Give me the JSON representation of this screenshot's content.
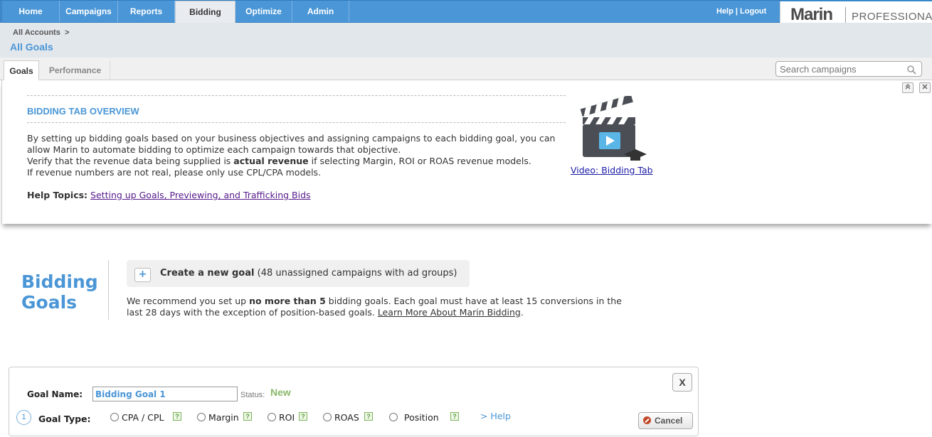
{
  "topnav": {
    "tabs": [
      {
        "label": "Home"
      },
      {
        "label": "Campaigns"
      },
      {
        "label": "Reports"
      },
      {
        "label": "Bidding",
        "active": true
      },
      {
        "label": "Optimize"
      },
      {
        "label": "Admin"
      }
    ],
    "help": "Help",
    "separator": "|",
    "logout": "Logout",
    "logo_word": "Marin",
    "logo_edition": "PROFESSIONAL"
  },
  "breadcrumb": {
    "parent": "All Accounts",
    "arrow": ">",
    "title": "All Goals"
  },
  "subtabs": [
    {
      "label": "Goals",
      "active": true
    },
    {
      "label": "Performance"
    }
  ],
  "search": {
    "placeholder": "Search campaigns",
    "icon": "search-icon"
  },
  "overview": {
    "title": "BIDDING TAB OVERVIEW",
    "para1": "By setting up bidding goals based on your business objectives and assigning campaigns to each bidding goal, you can allow Marin to automate bidding to optimize each campaign towards that objective.",
    "para2_pre": "Verify that the revenue data being supplied is ",
    "para2_bold": "actual revenue",
    "para2_post": " if selecting Margin, ROI or ROAS revenue models.",
    "para3": "If revenue numbers are not real, please only use CPL/CPA models.",
    "help_label": "Help Topics:",
    "help_link": "Setting up Goals, Previewing, and Trafficking Bids",
    "video_link": "Video: Bidding Tab",
    "collapse_icon": "collapse-up-icon",
    "close_icon": "close-icon"
  },
  "bidding": {
    "title_line1": "Bidding",
    "title_line2": "Goals",
    "create_plus": "+",
    "create_bold": "Create a new goal",
    "create_rest": " (48 unassigned campaigns with ad groups)",
    "rec_pre": "We recommend you set up ",
    "rec_bold": "no more than 5",
    "rec_mid": " bidding goals. Each goal must have at least 15 conversions in the last 28 days with the exception of position-based goals. ",
    "rec_link": "Learn More About Marin Bidding",
    "rec_end": "."
  },
  "goal_form": {
    "close": "X",
    "name_label": "Goal Name:",
    "name_value": "Bidding Goal 1",
    "status_label": "Status:",
    "status_value": "New",
    "step": "1",
    "type_label": "Goal Type:",
    "options": [
      "CPA / CPL",
      "Margin",
      "ROI",
      "ROAS",
      "Position"
    ],
    "qmark": "?",
    "help": "> Help",
    "cancel": "Cancel"
  },
  "colors": {
    "nav_blue": "#4a96d6",
    "title_blue": "#4a96d6",
    "status_green": "#8ab86a",
    "qmark_green": "#5a9a3c",
    "cancel_red": "#c24a2a"
  }
}
